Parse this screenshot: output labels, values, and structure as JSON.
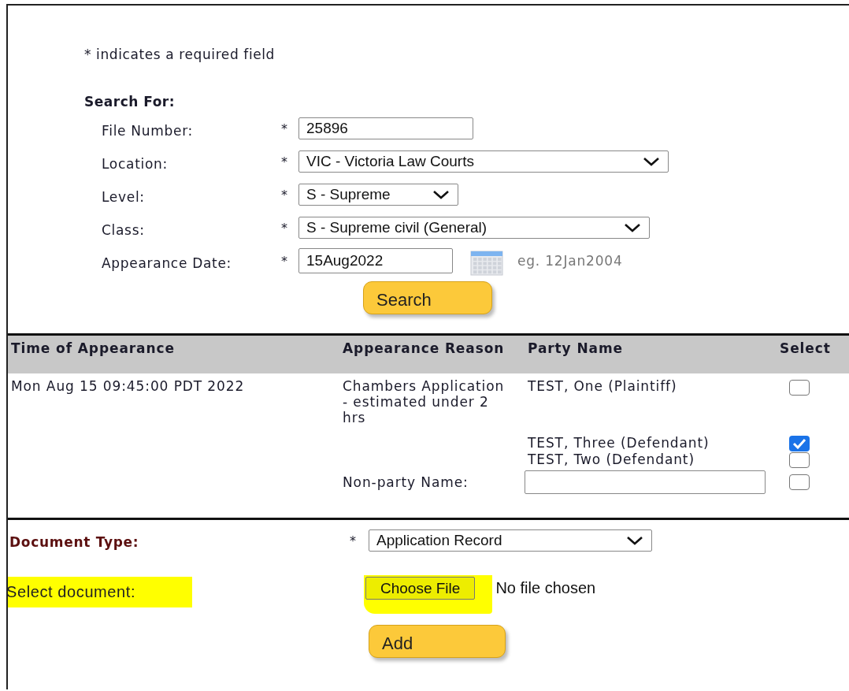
{
  "note": "* indicates a required field",
  "search": {
    "heading": "Search For:",
    "button": "Search",
    "fields": [
      {
        "kind": "text",
        "label": "File Number:",
        "mark": "*",
        "value": "25896"
      },
      {
        "kind": "select",
        "label": "Location:",
        "mark": "*",
        "value": "VIC - Victoria Law Courts"
      },
      {
        "kind": "select",
        "label": "Level:",
        "mark": "*",
        "value": "S - Supreme"
      },
      {
        "kind": "select",
        "label": "Class:",
        "mark": "*",
        "value": "S - Supreme civil (General)"
      },
      {
        "kind": "date",
        "label": "Appearance Date:",
        "mark": "*",
        "value": "15Aug2022",
        "hint": "eg. 12Jan2004"
      }
    ]
  },
  "table": {
    "columns": [
      "Time of Appearance",
      "Appearance Reason",
      "Party Name",
      "Select"
    ],
    "rows": [
      {
        "time": "Mon Aug 15 09:45:00 PDT 2022",
        "reason": "Chambers Application - estimated under 2 hrs",
        "parties": [
          {
            "name": "TEST, One (Plaintiff)",
            "checked": false
          },
          {
            "name": "TEST, Three (Defendant)",
            "checked": true
          },
          {
            "name": "TEST, Two (Defendant)",
            "checked": false
          }
        ]
      }
    ],
    "non_party": {
      "label": "Non-party Name:",
      "checked": false
    }
  },
  "document": {
    "type_label": "Document Type:",
    "mark": "*",
    "type_value": "Application Record",
    "select_label": "Select document:",
    "highlighted": true,
    "choose_button": "Choose File",
    "file_status": "No file chosen",
    "add_button": "Add"
  }
}
